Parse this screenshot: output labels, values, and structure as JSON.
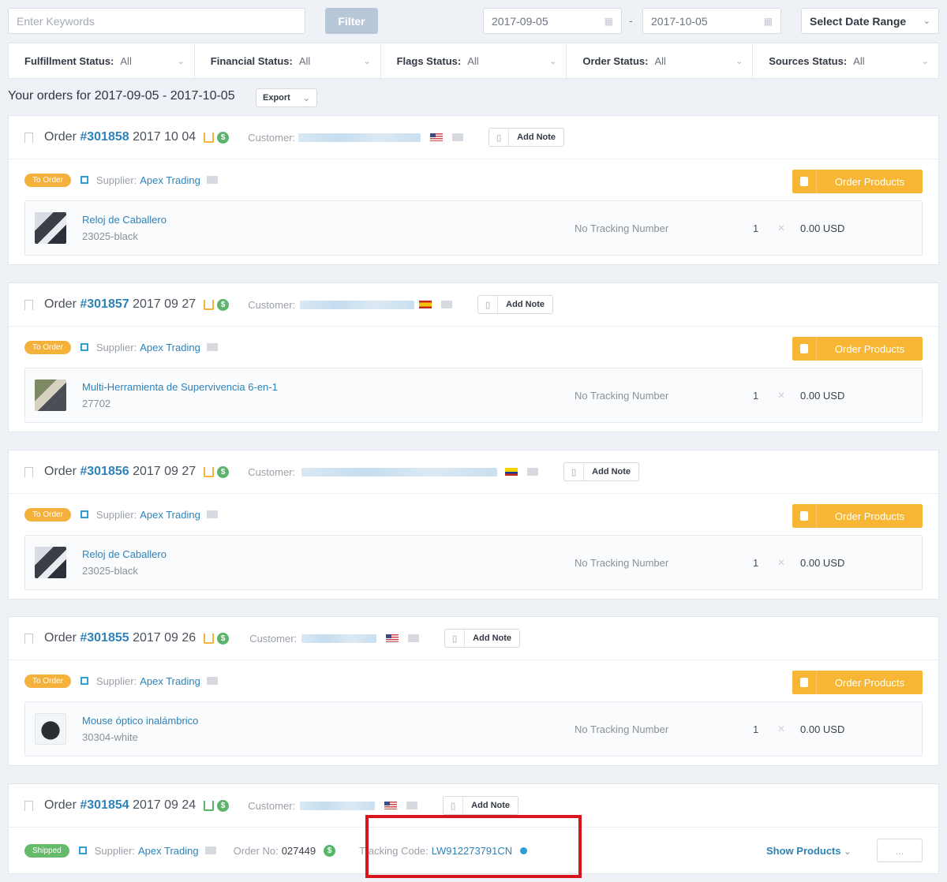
{
  "toolbar": {
    "keywords_placeholder": "Enter Keywords",
    "filter_label": "Filter",
    "date_from": "2017-09-05",
    "date_separator": "-",
    "date_to": "2017-10-05",
    "date_range_label": "Select Date Range"
  },
  "statuses": [
    {
      "label": "Fulfillment Status:",
      "value": "All"
    },
    {
      "label": "Financial Status:",
      "value": "All"
    },
    {
      "label": "Flags Status:",
      "value": "All"
    },
    {
      "label": "Order Status:",
      "value": "All"
    },
    {
      "label": "Sources Status:",
      "value": "All"
    }
  ],
  "orders_heading": "Your orders for 2017-09-05 - 2017-10-05",
  "export_label": "Export",
  "labels": {
    "order": "Order",
    "customer": "Customer:",
    "add_note": "Add Note",
    "supplier": "Supplier:",
    "order_products": "Order Products",
    "no_tracking": "No Tracking Number",
    "order_no": "Order No:",
    "tracking_code": "Tracking Code:",
    "show_products": "Show Products"
  },
  "orders": [
    {
      "number": "#301858",
      "date": "2017 10 04",
      "flag": "us",
      "status": "To Order",
      "supplier": "Apex Trading",
      "product": {
        "name": "Reloj de Caballero",
        "sku": "23025-black",
        "qty": "1",
        "price": "0.00 USD"
      }
    },
    {
      "number": "#301857",
      "date": "2017 09 27",
      "flag": "es",
      "status": "To Order",
      "supplier": "Apex Trading",
      "product": {
        "name": "Multi-Herramienta de Supervivencia 6-en-1",
        "sku": "27702",
        "qty": "1",
        "price": "0.00 USD"
      }
    },
    {
      "number": "#301856",
      "date": "2017 09 27",
      "flag": "co",
      "status": "To Order",
      "supplier": "Apex Trading",
      "product": {
        "name": "Reloj de Caballero",
        "sku": "23025-black",
        "qty": "1",
        "price": "0.00 USD"
      }
    },
    {
      "number": "#301855",
      "date": "2017 09 26",
      "flag": "us",
      "status": "To Order",
      "supplier": "Apex Trading",
      "product": {
        "name": "Mouse óptico inalámbrico",
        "sku": "30304-white",
        "qty": "1",
        "price": "0.00 USD"
      }
    },
    {
      "number": "#301854",
      "date": "2017 09 24",
      "flag": "us",
      "status": "Shipped",
      "supplier": "Apex Trading",
      "order_no": "027449",
      "tracking_code": "LW912273791CN"
    }
  ],
  "more_label": "...",
  "colors": {
    "accent_blue": "#2d82b8",
    "orange": "#f7b633",
    "green": "#66bb6a",
    "highlight_red": "#d8151c"
  }
}
